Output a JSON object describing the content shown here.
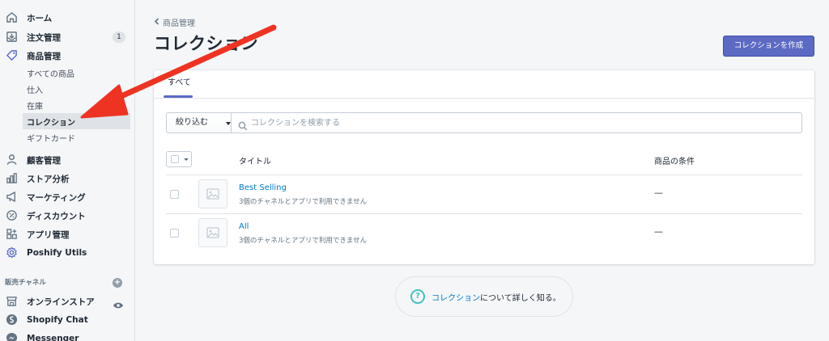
{
  "sidebar": {
    "items": [
      {
        "label": "ホーム",
        "icon": "home-icon"
      },
      {
        "label": "注文管理",
        "icon": "orders-icon",
        "badge": "1"
      },
      {
        "label": "商品管理",
        "icon": "tag-icon"
      },
      {
        "label": "顧客管理",
        "icon": "customer-icon"
      },
      {
        "label": "ストア分析",
        "icon": "analytics-icon"
      },
      {
        "label": "マーケティング",
        "icon": "marketing-icon"
      },
      {
        "label": "ディスカウント",
        "icon": "discount-icon"
      },
      {
        "label": "アプリ管理",
        "icon": "apps-icon"
      },
      {
        "label": "Poshify Utils",
        "icon": "gear-icon"
      }
    ],
    "sub_items": [
      "すべての商品",
      "仕入",
      "在庫",
      "コレクション",
      "ギフトカード"
    ],
    "sales_channels_heading": "販売チャネル",
    "channels": [
      {
        "label": "オンラインストア",
        "icon": "store-icon"
      },
      {
        "label": "Shopify Chat",
        "icon": "shopify-icon"
      },
      {
        "label": "Messenger",
        "icon": "messenger-icon"
      }
    ]
  },
  "breadcrumb": "商品管理",
  "page_title": "コレクション",
  "create_button": "コレクションを作成",
  "tabs": [
    "すべて"
  ],
  "filter": {
    "button": "絞り込む",
    "search_placeholder": "コレクションを検索する"
  },
  "table": {
    "headers": [
      "タイトル",
      "商品の条件"
    ],
    "rows": [
      {
        "title": "Best Selling",
        "subtitle": "3個のチャネルとアプリで利用できません",
        "condition": "—"
      },
      {
        "title": "All",
        "subtitle": "3個のチャネルとアプリで利用できません",
        "condition": "—"
      }
    ]
  },
  "help": {
    "link": "コレクション",
    "text": "について詳しく知る。"
  },
  "colors": {
    "accent": "#5c6ac4",
    "link": "#007ace",
    "arrow": "#ee3322",
    "help": "#47c1bf"
  }
}
